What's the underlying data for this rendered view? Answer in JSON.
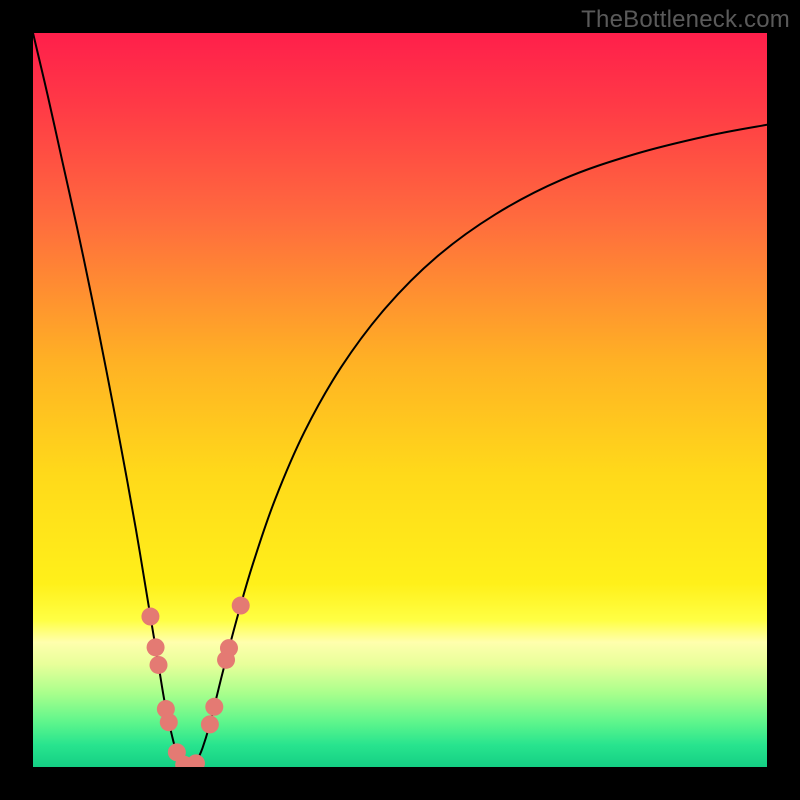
{
  "watermark": "TheBottleneck.com",
  "chart_data": {
    "type": "line",
    "title": "",
    "xlabel": "",
    "ylabel": "",
    "xlim": [
      0,
      100
    ],
    "ylim": [
      0,
      100
    ],
    "background_gradient": {
      "stops": [
        {
          "pos": 0.0,
          "color": "#ff1f4b"
        },
        {
          "pos": 0.1,
          "color": "#ff3a46"
        },
        {
          "pos": 0.25,
          "color": "#ff6a3e"
        },
        {
          "pos": 0.45,
          "color": "#ffb224"
        },
        {
          "pos": 0.6,
          "color": "#ffd91a"
        },
        {
          "pos": 0.75,
          "color": "#fff01a"
        },
        {
          "pos": 0.8,
          "color": "#ffff44"
        },
        {
          "pos": 0.83,
          "color": "#ffffad"
        },
        {
          "pos": 0.86,
          "color": "#e8ff9a"
        },
        {
          "pos": 0.9,
          "color": "#a8ff8c"
        },
        {
          "pos": 0.94,
          "color": "#5cf58c"
        },
        {
          "pos": 0.97,
          "color": "#28e48e"
        },
        {
          "pos": 1.0,
          "color": "#14cf84"
        }
      ]
    },
    "series": [
      {
        "name": "bottleneck-curve",
        "color": "#000000",
        "stroke_width": 2,
        "x": [
          0.0,
          2.0,
          4.0,
          6.0,
          8.0,
          10.0,
          12.0,
          14.0,
          16.0,
          17.0,
          18.0,
          19.0,
          19.5,
          20.0,
          20.5,
          21.0,
          21.6,
          22.0,
          22.5,
          23.1,
          24.0,
          25.0,
          26.0,
          28.0,
          30.0,
          33.0,
          37.0,
          42.0,
          48.0,
          55.0,
          63.0,
          72.0,
          82.0,
          92.0,
          100.0
        ],
        "y_percent": [
          100.0,
          91.5,
          82.5,
          73.5,
          64.0,
          54.0,
          43.5,
          32.5,
          20.5,
          14.5,
          8.5,
          4.0,
          2.2,
          1.1,
          0.4,
          0.0,
          0.0,
          0.3,
          1.2,
          2.6,
          5.5,
          9.5,
          13.5,
          21.0,
          27.8,
          36.5,
          45.7,
          54.5,
          62.5,
          69.5,
          75.3,
          80.0,
          83.5,
          86.0,
          87.5
        ]
      }
    ],
    "markers": {
      "color": "#e47a73",
      "radius": 9,
      "points": [
        {
          "x": 16.0,
          "y_percent": 20.5
        },
        {
          "x": 16.7,
          "y_percent": 16.3
        },
        {
          "x": 17.1,
          "y_percent": 13.9
        },
        {
          "x": 18.1,
          "y_percent": 7.9
        },
        {
          "x": 18.5,
          "y_percent": 6.1
        },
        {
          "x": 19.6,
          "y_percent": 2.0
        },
        {
          "x": 20.6,
          "y_percent": 0.3
        },
        {
          "x": 21.4,
          "y_percent": 0.0
        },
        {
          "x": 22.2,
          "y_percent": 0.5
        },
        {
          "x": 24.1,
          "y_percent": 5.8
        },
        {
          "x": 24.7,
          "y_percent": 8.2
        },
        {
          "x": 26.3,
          "y_percent": 14.6
        },
        {
          "x": 26.7,
          "y_percent": 16.2
        },
        {
          "x": 28.3,
          "y_percent": 22.0
        }
      ]
    }
  }
}
